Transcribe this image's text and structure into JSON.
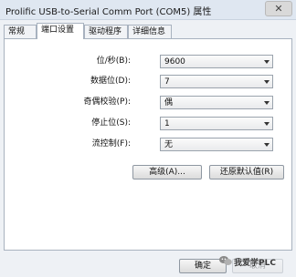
{
  "window": {
    "title": "Prolific USB-to-Serial Comm Port (COM5) 属性"
  },
  "tabs": [
    {
      "label": "常规"
    },
    {
      "label": "端口设置"
    },
    {
      "label": "驱动程序"
    },
    {
      "label": "详细信息"
    }
  ],
  "settings": {
    "baud": {
      "label": "位/秒(B):",
      "value": "9600"
    },
    "data_bits": {
      "label": "数据位(D):",
      "value": "7"
    },
    "parity": {
      "label": "奇偶校验(P):",
      "value": "偶"
    },
    "stop_bits": {
      "label": "停止位(S):",
      "value": "1"
    },
    "flow": {
      "label": "流控制(F):",
      "value": "无"
    }
  },
  "buttons": {
    "advanced": "高级(A)...",
    "restore": "还原默认值(R)",
    "ok": "确定",
    "cancel": "取消"
  },
  "watermark": {
    "text": "我爱学PLC"
  }
}
